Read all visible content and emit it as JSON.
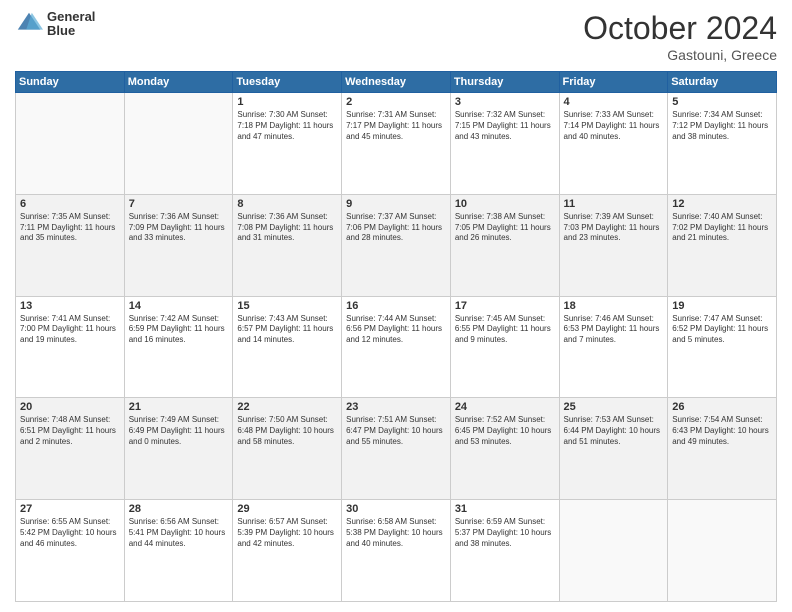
{
  "header": {
    "logo_line1": "General",
    "logo_line2": "Blue",
    "month": "October 2024",
    "location": "Gastouni, Greece"
  },
  "weekdays": [
    "Sunday",
    "Monday",
    "Tuesday",
    "Wednesday",
    "Thursday",
    "Friday",
    "Saturday"
  ],
  "weeks": [
    [
      {
        "day": "",
        "info": ""
      },
      {
        "day": "",
        "info": ""
      },
      {
        "day": "1",
        "info": "Sunrise: 7:30 AM\nSunset: 7:18 PM\nDaylight: 11 hours and 47 minutes."
      },
      {
        "day": "2",
        "info": "Sunrise: 7:31 AM\nSunset: 7:17 PM\nDaylight: 11 hours and 45 minutes."
      },
      {
        "day": "3",
        "info": "Sunrise: 7:32 AM\nSunset: 7:15 PM\nDaylight: 11 hours and 43 minutes."
      },
      {
        "day": "4",
        "info": "Sunrise: 7:33 AM\nSunset: 7:14 PM\nDaylight: 11 hours and 40 minutes."
      },
      {
        "day": "5",
        "info": "Sunrise: 7:34 AM\nSunset: 7:12 PM\nDaylight: 11 hours and 38 minutes."
      }
    ],
    [
      {
        "day": "6",
        "info": "Sunrise: 7:35 AM\nSunset: 7:11 PM\nDaylight: 11 hours and 35 minutes."
      },
      {
        "day": "7",
        "info": "Sunrise: 7:36 AM\nSunset: 7:09 PM\nDaylight: 11 hours and 33 minutes."
      },
      {
        "day": "8",
        "info": "Sunrise: 7:36 AM\nSunset: 7:08 PM\nDaylight: 11 hours and 31 minutes."
      },
      {
        "day": "9",
        "info": "Sunrise: 7:37 AM\nSunset: 7:06 PM\nDaylight: 11 hours and 28 minutes."
      },
      {
        "day": "10",
        "info": "Sunrise: 7:38 AM\nSunset: 7:05 PM\nDaylight: 11 hours and 26 minutes."
      },
      {
        "day": "11",
        "info": "Sunrise: 7:39 AM\nSunset: 7:03 PM\nDaylight: 11 hours and 23 minutes."
      },
      {
        "day": "12",
        "info": "Sunrise: 7:40 AM\nSunset: 7:02 PM\nDaylight: 11 hours and 21 minutes."
      }
    ],
    [
      {
        "day": "13",
        "info": "Sunrise: 7:41 AM\nSunset: 7:00 PM\nDaylight: 11 hours and 19 minutes."
      },
      {
        "day": "14",
        "info": "Sunrise: 7:42 AM\nSunset: 6:59 PM\nDaylight: 11 hours and 16 minutes."
      },
      {
        "day": "15",
        "info": "Sunrise: 7:43 AM\nSunset: 6:57 PM\nDaylight: 11 hours and 14 minutes."
      },
      {
        "day": "16",
        "info": "Sunrise: 7:44 AM\nSunset: 6:56 PM\nDaylight: 11 hours and 12 minutes."
      },
      {
        "day": "17",
        "info": "Sunrise: 7:45 AM\nSunset: 6:55 PM\nDaylight: 11 hours and 9 minutes."
      },
      {
        "day": "18",
        "info": "Sunrise: 7:46 AM\nSunset: 6:53 PM\nDaylight: 11 hours and 7 minutes."
      },
      {
        "day": "19",
        "info": "Sunrise: 7:47 AM\nSunset: 6:52 PM\nDaylight: 11 hours and 5 minutes."
      }
    ],
    [
      {
        "day": "20",
        "info": "Sunrise: 7:48 AM\nSunset: 6:51 PM\nDaylight: 11 hours and 2 minutes."
      },
      {
        "day": "21",
        "info": "Sunrise: 7:49 AM\nSunset: 6:49 PM\nDaylight: 11 hours and 0 minutes."
      },
      {
        "day": "22",
        "info": "Sunrise: 7:50 AM\nSunset: 6:48 PM\nDaylight: 10 hours and 58 minutes."
      },
      {
        "day": "23",
        "info": "Sunrise: 7:51 AM\nSunset: 6:47 PM\nDaylight: 10 hours and 55 minutes."
      },
      {
        "day": "24",
        "info": "Sunrise: 7:52 AM\nSunset: 6:45 PM\nDaylight: 10 hours and 53 minutes."
      },
      {
        "day": "25",
        "info": "Sunrise: 7:53 AM\nSunset: 6:44 PM\nDaylight: 10 hours and 51 minutes."
      },
      {
        "day": "26",
        "info": "Sunrise: 7:54 AM\nSunset: 6:43 PM\nDaylight: 10 hours and 49 minutes."
      }
    ],
    [
      {
        "day": "27",
        "info": "Sunrise: 6:55 AM\nSunset: 5:42 PM\nDaylight: 10 hours and 46 minutes."
      },
      {
        "day": "28",
        "info": "Sunrise: 6:56 AM\nSunset: 5:41 PM\nDaylight: 10 hours and 44 minutes."
      },
      {
        "day": "29",
        "info": "Sunrise: 6:57 AM\nSunset: 5:39 PM\nDaylight: 10 hours and 42 minutes."
      },
      {
        "day": "30",
        "info": "Sunrise: 6:58 AM\nSunset: 5:38 PM\nDaylight: 10 hours and 40 minutes."
      },
      {
        "day": "31",
        "info": "Sunrise: 6:59 AM\nSunset: 5:37 PM\nDaylight: 10 hours and 38 minutes."
      },
      {
        "day": "",
        "info": ""
      },
      {
        "day": "",
        "info": ""
      }
    ]
  ]
}
